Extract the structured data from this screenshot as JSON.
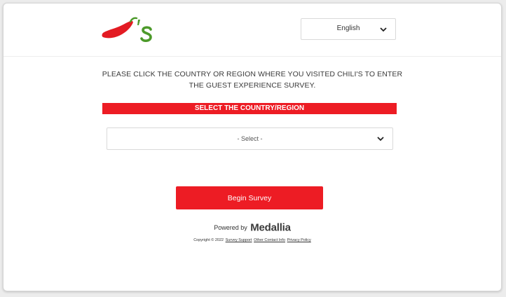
{
  "header": {
    "logo_alt": "Chili's",
    "language": {
      "selected": "English"
    }
  },
  "main": {
    "instruction_line1": "PLEASE CLICK THE COUNTRY OR REGION WHERE YOU VISITED CHILI'S TO ENTER",
    "instruction_line2": "THE GUEST EXPERIENCE SURVEY.",
    "section_title": "SELECT THE COUNTRY/REGION",
    "country_select": {
      "selected": "- Select -"
    },
    "begin_button": "Begin Survey"
  },
  "footer": {
    "powered_by": "Powered by",
    "brand": "Medallia",
    "copyright": "Copyright © 2022",
    "links": [
      "Survey Support",
      "Other Contact Info",
      "Privacy Policy"
    ]
  },
  "colors": {
    "accent_red": "#ed1c24",
    "logo_green": "#4c9a2a"
  }
}
